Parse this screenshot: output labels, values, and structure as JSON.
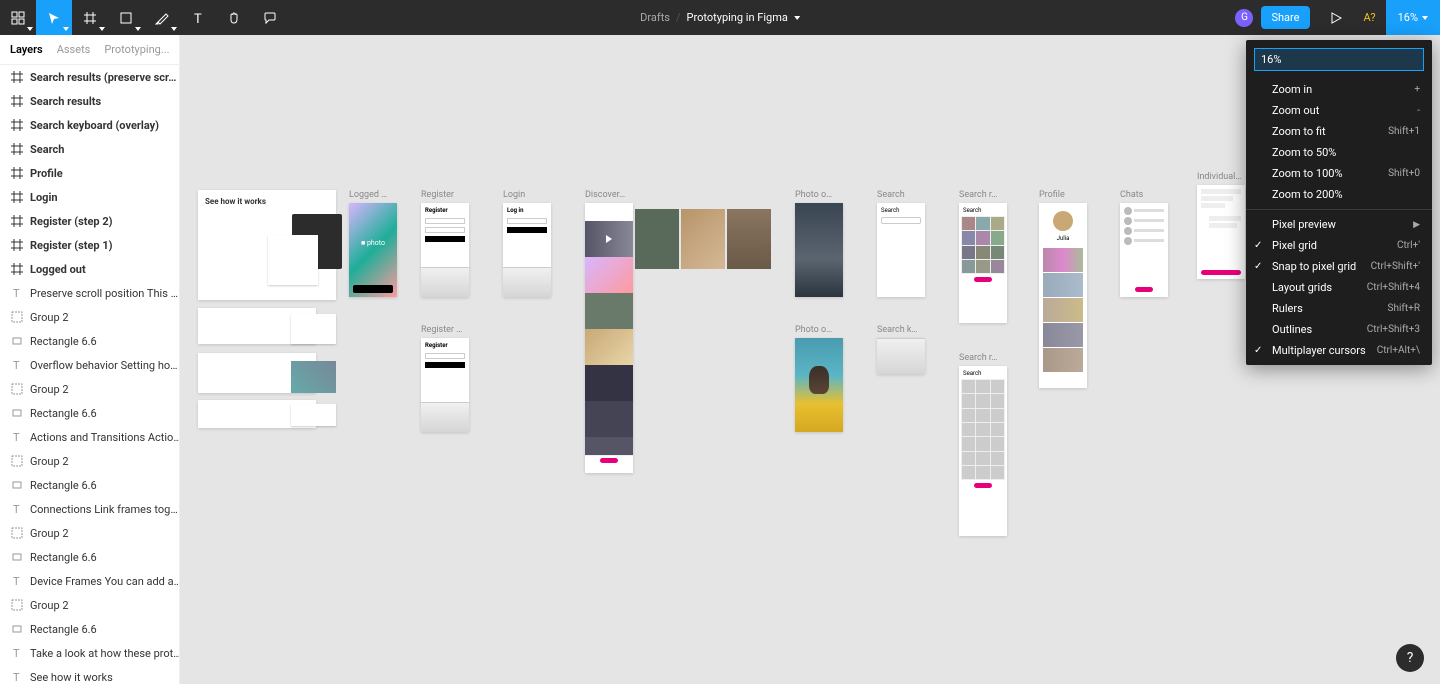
{
  "toolbar": {
    "breadcrumb_drafts": "Drafts",
    "breadcrumb_title": "Prototyping in Figma",
    "avatar_letter": "G",
    "share_label": "Share",
    "a_q": "A?",
    "zoom_label": "16%"
  },
  "panel": {
    "tabs": {
      "layers": "Layers",
      "assets": "Assets",
      "page": "Prototyping..."
    },
    "layers": [
      {
        "icon": "frame",
        "label": "Search results (preserve scr…",
        "bold": true
      },
      {
        "icon": "frame",
        "label": "Search results",
        "bold": true
      },
      {
        "icon": "frame",
        "label": "Search keyboard (overlay)",
        "bold": true
      },
      {
        "icon": "frame",
        "label": "Search",
        "bold": true
      },
      {
        "icon": "frame",
        "label": "Profile",
        "bold": true
      },
      {
        "icon": "frame",
        "label": "Login",
        "bold": true
      },
      {
        "icon": "frame",
        "label": "Register (step 2)",
        "bold": true
      },
      {
        "icon": "frame",
        "label": "Register (step 1)",
        "bold": true
      },
      {
        "icon": "frame",
        "label": "Logged out",
        "bold": true
      },
      {
        "icon": "text",
        "label": "Preserve scroll position This …",
        "bold": false
      },
      {
        "icon": "group",
        "label": "Group 2",
        "bold": false
      },
      {
        "icon": "rect",
        "label": "Rectangle 6.6",
        "bold": false
      },
      {
        "icon": "text",
        "label": "Overflow behavior Setting ho…",
        "bold": false
      },
      {
        "icon": "group",
        "label": "Group 2",
        "bold": false
      },
      {
        "icon": "rect",
        "label": "Rectangle 6.6",
        "bold": false
      },
      {
        "icon": "text",
        "label": "Actions and Transitions Actio…",
        "bold": false
      },
      {
        "icon": "group",
        "label": "Group 2",
        "bold": false
      },
      {
        "icon": "rect",
        "label": "Rectangle 6.6",
        "bold": false
      },
      {
        "icon": "text",
        "label": "Connections Link frames tog…",
        "bold": false
      },
      {
        "icon": "group",
        "label": "Group 2",
        "bold": false
      },
      {
        "icon": "rect",
        "label": "Rectangle 6.6",
        "bold": false
      },
      {
        "icon": "text",
        "label": "Device Frames You can add a…",
        "bold": false
      },
      {
        "icon": "group",
        "label": "Group 2",
        "bold": false
      },
      {
        "icon": "rect",
        "label": "Rectangle 6.6",
        "bold": false
      },
      {
        "icon": "text",
        "label": "Take a look at how these prot…",
        "bold": false
      },
      {
        "icon": "text",
        "label": "See how it works",
        "bold": false
      }
    ]
  },
  "canvas": {
    "see_how": "See how it works",
    "frames": {
      "logged_out": "Logged …",
      "register": "Register",
      "register2": "Register …",
      "login": "Login",
      "login_title": "Log in",
      "discover": "Discover…",
      "photo": "Photo o…",
      "search": "Search",
      "search_k": "Search k…",
      "search_r": "Search r…",
      "search_r2": "Search r…",
      "profile": "Profile",
      "chats": "Chats",
      "individual": "Individual…",
      "photo_brand": "photo",
      "julia": "Julia"
    }
  },
  "zoom_menu": {
    "input_value": "16%",
    "items1": [
      {
        "label": "Zoom in",
        "shortcut": "+"
      },
      {
        "label": "Zoom out",
        "shortcut": "-"
      },
      {
        "label": "Zoom to fit",
        "shortcut": "Shift+1"
      },
      {
        "label": "Zoom to 50%",
        "shortcut": ""
      },
      {
        "label": "Zoom to 100%",
        "shortcut": "Shift+0"
      },
      {
        "label": "Zoom to 200%",
        "shortcut": ""
      }
    ],
    "items2": [
      {
        "label": "Pixel preview",
        "shortcut": "",
        "arrow": true,
        "checked": false
      },
      {
        "label": "Pixel grid",
        "shortcut": "Ctrl+'",
        "checked": true
      },
      {
        "label": "Snap to pixel grid",
        "shortcut": "Ctrl+Shift+'",
        "checked": true
      },
      {
        "label": "Layout grids",
        "shortcut": "Ctrl+Shift+4",
        "checked": false
      },
      {
        "label": "Rulers",
        "shortcut": "Shift+R",
        "checked": false
      },
      {
        "label": "Outlines",
        "shortcut": "Ctrl+Shift+3",
        "checked": false
      },
      {
        "label": "Multiplayer cursors",
        "shortcut": "Ctrl+Alt+\\",
        "checked": true
      }
    ]
  },
  "help": "?"
}
